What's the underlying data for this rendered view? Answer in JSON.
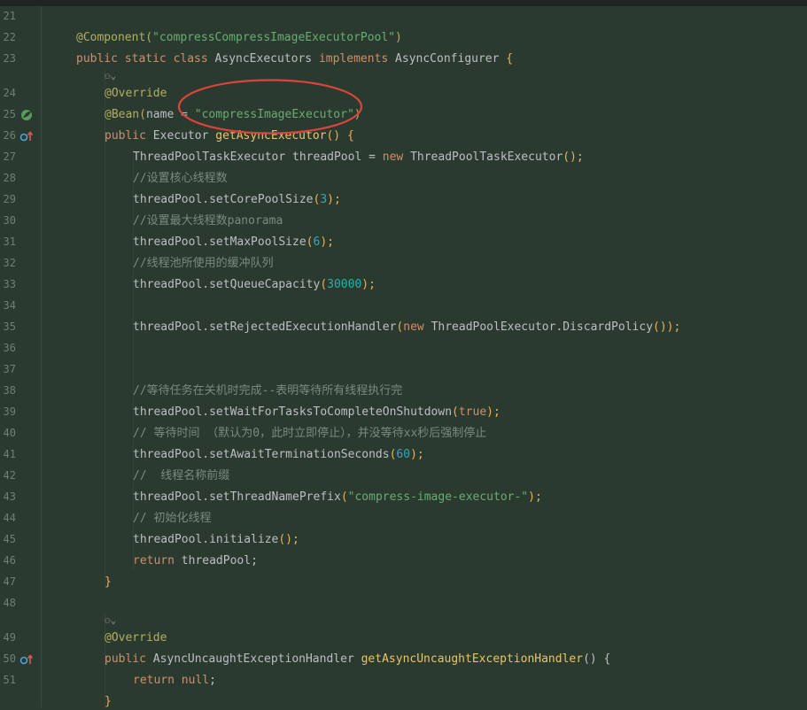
{
  "editor": {
    "line_numbers": [
      "21",
      "22",
      "23",
      "24",
      "25",
      "26",
      "27",
      "28",
      "29",
      "30",
      "31",
      "32",
      "33",
      "34",
      "35",
      "36",
      "37",
      "38",
      "39",
      "40",
      "41",
      "42",
      "43",
      "44",
      "45",
      "46",
      "47",
      "48",
      "49",
      "50",
      "51"
    ],
    "lines": {
      "l22": [
        "@Component(",
        "\"compressCompressImageExecutorPool\"",
        ")"
      ],
      "l23": [
        "public static class ",
        "AsyncExecutors ",
        "implements ",
        "AsyncConfigurer ",
        "{"
      ],
      "l24": [
        "@Override"
      ],
      "l25": [
        "@Bean(",
        "name",
        " = ",
        "\"compressImageExecutor\"",
        ")"
      ],
      "l26": [
        "public ",
        "Executor ",
        "getAsyncExecutor",
        "() {"
      ],
      "l27": [
        "ThreadPoolTaskExecutor threadPool = ",
        "new ",
        "ThreadPoolTaskExecutor",
        "();"
      ],
      "l28": [
        "//设置核心线程数"
      ],
      "l29": [
        "threadPool.setCorePoolSize",
        "(",
        "3",
        ");"
      ],
      "l30": [
        "//设置最大线程数panorama"
      ],
      "l31": [
        "threadPool.setMaxPoolSize",
        "(",
        "6",
        ");"
      ],
      "l32": [
        "//线程池所使用的缓冲队列"
      ],
      "l33": [
        "threadPool.setQueueCapacity",
        "(",
        "30000",
        ");"
      ],
      "l35": [
        "threadPool.setRejectedExecutionHandler",
        "(",
        "new ",
        "ThreadPoolExecutor.DiscardPolicy",
        "());"
      ],
      "l38": [
        "//等待任务在关机时完成--表明等待所有线程执行完"
      ],
      "l39": [
        "threadPool.setWaitForTasksToCompleteOnShutdown",
        "(",
        "true",
        ");"
      ],
      "l40": [
        "// 等待时间 （默认为0，此时立即停止），并没等待xx秒后强制停止"
      ],
      "l41": [
        "threadPool.setAwaitTerminationSeconds",
        "(",
        "60",
        ");"
      ],
      "l42": [
        "//  线程名称前缀"
      ],
      "l43": [
        "threadPool.setThreadNamePrefix",
        "(",
        "\"compress-image-executor-\"",
        ");"
      ],
      "l44": [
        "// 初始化线程"
      ],
      "l45": [
        "threadPool.initialize",
        "();"
      ],
      "l46": [
        "return ",
        "threadPool;"
      ],
      "l47": [
        "}"
      ],
      "l49": [
        "@Override"
      ],
      "l50": [
        "public ",
        "AsyncUncaughtExceptionHandler ",
        "getAsyncUncaughtExceptionHandler",
        "() {"
      ],
      "l51": [
        "return null",
        ";"
      ],
      "l52": [
        "}"
      ]
    }
  },
  "icons": {
    "inlay_hint": "usage-hint-icon",
    "bean_gutter": "spring-bean-gutter-icon",
    "override_gutter": "override-gutter-icon"
  },
  "colors": {
    "background": "#2b3a2f",
    "annotation_circle": "#d9453c"
  }
}
